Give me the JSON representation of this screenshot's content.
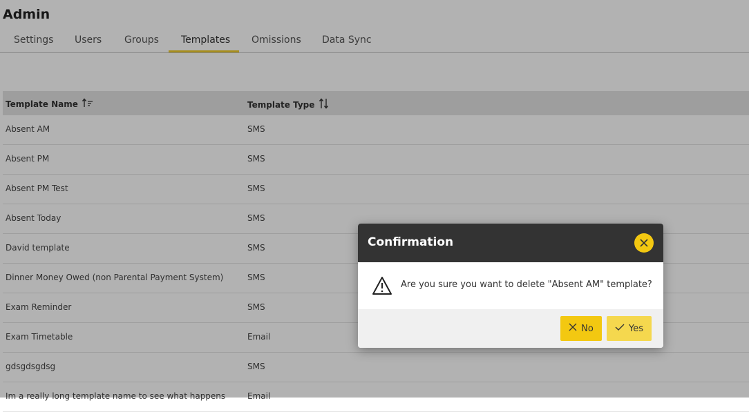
{
  "header": {
    "title": "Admin"
  },
  "tabs": [
    {
      "label": "Settings"
    },
    {
      "label": "Users"
    },
    {
      "label": "Groups"
    },
    {
      "label": "Templates"
    },
    {
      "label": "Omissions"
    },
    {
      "label": "Data Sync"
    }
  ],
  "active_tab": "Templates",
  "table": {
    "columns": [
      "Template Name",
      "Template Type"
    ],
    "rows": [
      {
        "name": "Absent AM",
        "type": "SMS"
      },
      {
        "name": "Absent PM",
        "type": "SMS"
      },
      {
        "name": "Absent PM Test",
        "type": "SMS"
      },
      {
        "name": "Absent Today",
        "type": "SMS"
      },
      {
        "name": "David template",
        "type": "SMS"
      },
      {
        "name": "Dinner Money Owed (non Parental Payment System)",
        "type": "SMS"
      },
      {
        "name": "Exam Reminder",
        "type": "SMS"
      },
      {
        "name": "Exam Timetable",
        "type": "Email"
      },
      {
        "name": "gdsgdsgdsg",
        "type": "SMS"
      },
      {
        "name": "Im a really long template name to see what happens",
        "type": "Email"
      }
    ]
  },
  "dialog": {
    "title": "Confirmation",
    "message": "Are you sure you want to delete \"Absent AM\" template?",
    "no_label": "No",
    "yes_label": "Yes"
  },
  "colors": {
    "accent": "#f3c811",
    "dialog_header": "#333333",
    "table_header": "#e3e3e3"
  },
  "icons": {
    "sort_name": "sort-ascending-icon",
    "sort_type": "sort-both-icon",
    "close": "close-icon",
    "warning": "warning-icon",
    "no": "x-icon",
    "yes": "check-icon"
  }
}
